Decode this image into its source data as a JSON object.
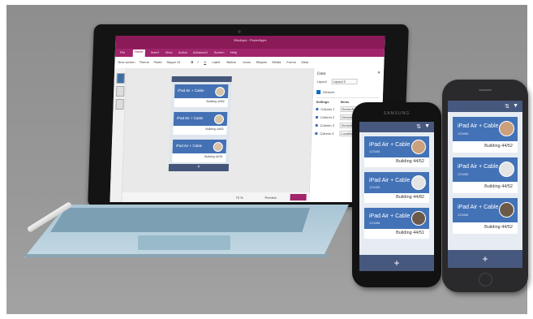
{
  "laptop": {
    "window_title": "Mockups - PowerApps",
    "tabs": [
      "File",
      "Home",
      "Insert",
      "View",
      "Action",
      "Advanced",
      "Screen",
      "Help"
    ],
    "active_tab": "Home",
    "tools": [
      "New screen",
      "Theme",
      "Paste",
      "Segoe UI",
      "B",
      "I",
      "U",
      "Label",
      "Button",
      "Icons",
      "Shapes",
      "Media",
      "Forms",
      "Data"
    ],
    "right_pane": {
      "title": "Data",
      "layout_label": "Layout",
      "layout_value": "Layout 2",
      "source": "Devices",
      "fields_header": "Fields",
      "col_left": "Settings",
      "col_right": "Items",
      "rows": [
        "Column 1",
        "Column 2",
        "Column 3",
        "Column 4"
      ],
      "values": [
        "DeviceName",
        "DeviceID",
        "DeviceLocation",
        "Location"
      ]
    },
    "mini_cards": [
      {
        "title": "iPad Air + Cable",
        "building": "Building 44/52"
      },
      {
        "title": "iPad Air + Cable",
        "building": "Building 44/62"
      },
      {
        "title": "iPad Air + Cable",
        "building": "Building 44/32"
      }
    ],
    "add_symbol": "+",
    "zoom_label": "70 %",
    "preview_label": "Preview"
  },
  "phone_left": {
    "brand": "SAMSUNG",
    "cards": [
      {
        "title": "iPad Air + Cable",
        "id": "123456",
        "building": "Building 44/52"
      },
      {
        "title": "iPad Air + Cable",
        "id": "123456",
        "building": "Building 44/82"
      },
      {
        "title": "iPad Air + Cable",
        "id": "123456",
        "building": "Building 44/51"
      }
    ],
    "add_symbol": "+"
  },
  "phone_right": {
    "cards": [
      {
        "title": "iPad Air + Cable",
        "id": "123456",
        "building": "Building 44/52"
      },
      {
        "title": "iPad Air + Cable",
        "id": "123456",
        "building": "Building 44/52"
      },
      {
        "title": "iPad Air + Cable",
        "id": "123456",
        "building": "Building 44/52"
      }
    ],
    "add_symbol": "+"
  },
  "colors": {
    "ribbon": "#8a1a58",
    "card_band": "#4372b7",
    "app_header": "#47587e"
  }
}
